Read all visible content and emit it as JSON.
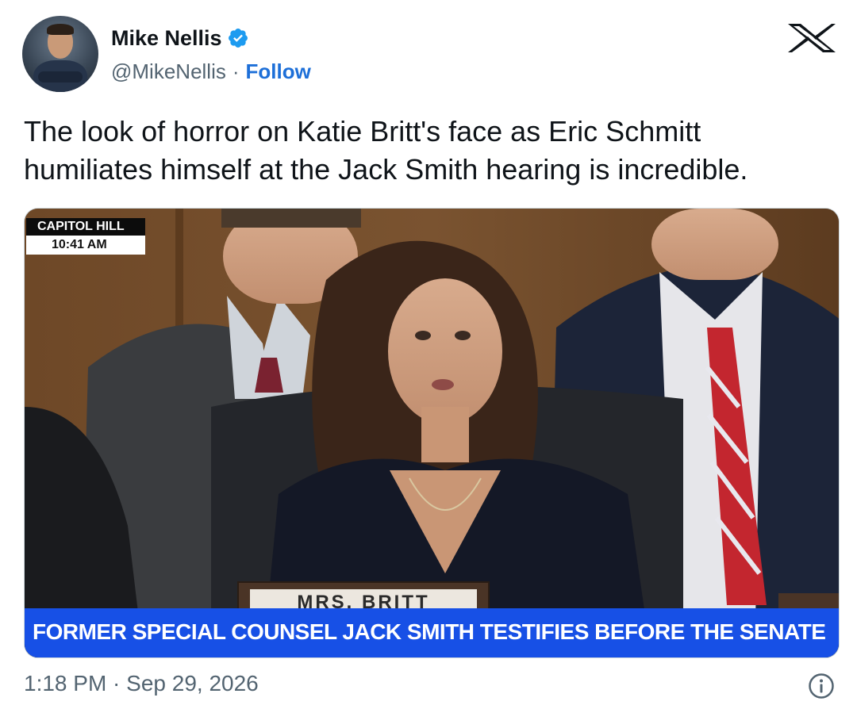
{
  "author": {
    "display_name": "Mike Nellis",
    "handle": "@MikeNellis",
    "separator": "·",
    "follow_label": "Follow",
    "verified_icon": "verified-badge-icon",
    "verified_color": "#1d9bf0"
  },
  "platform": {
    "logo": "x-logo-icon"
  },
  "tweet": {
    "text": "The look of horror on Katie Britt's face as Eric Schmitt humiliates himself at the Jack Smith hearing is incredible."
  },
  "media": {
    "bug_location": "CAPITOL HILL",
    "bug_time": "10:41 AM",
    "nameplate": "MRS. BRITT",
    "chyron": "FORMER SPECIAL COUNSEL JACK SMITH TESTIFIES BEFORE THE SENATE",
    "chyron_color": "#1750e6"
  },
  "footer": {
    "timestamp": "1:18 PM · Sep 29, 2026",
    "info_icon": "info-icon"
  },
  "colors": {
    "text_primary": "#0f1419",
    "text_secondary": "#536471",
    "link": "#1d6fd8"
  }
}
